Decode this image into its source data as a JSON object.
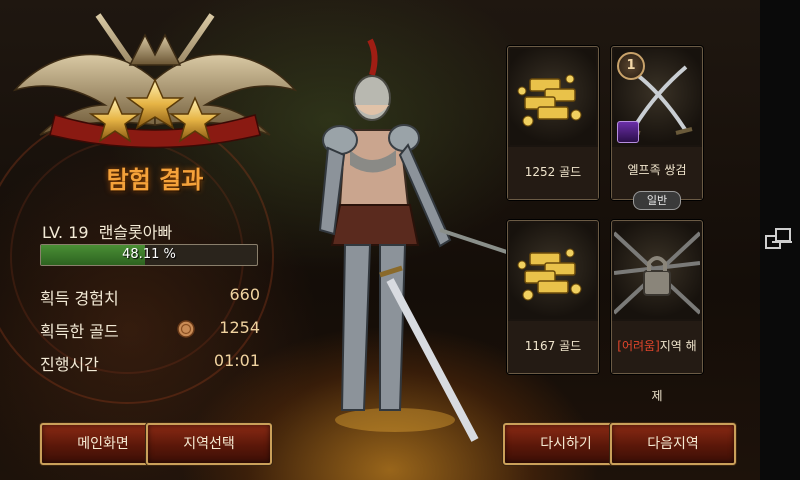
{
  "result": {
    "title": "탐험 결과",
    "level_label": "LV. 19",
    "character_name": "랜슬롯아빠",
    "xp_percent_text": "48.11 %",
    "xp_fraction": 0.4811,
    "stars_earned": 3
  },
  "stats": {
    "xp_label": "획득 경험치",
    "xp_value": "660",
    "gold_label": "획득한 골드",
    "gold_value": "1254",
    "time_label": "진행시간",
    "time_value": "01:01"
  },
  "rewards": {
    "card1_caption": "1252 골드",
    "card2_caption": "엘프족 쌍검",
    "card2_count": "1",
    "card2_grade": "일반",
    "card3_caption": "1167 골드",
    "card4_tag": "[어려움]",
    "card4_rest": "지역 해제"
  },
  "buttons": {
    "main": "메인화면",
    "region": "지역선택",
    "retry": "다시하기",
    "next": "다음지역"
  },
  "colors": {
    "accent_orange": "#f5a23a",
    "xp_green": "#3f7f2c",
    "button_red": "#6a1c0b",
    "button_border": "#caa05a",
    "hard_red": "#e0452b"
  }
}
